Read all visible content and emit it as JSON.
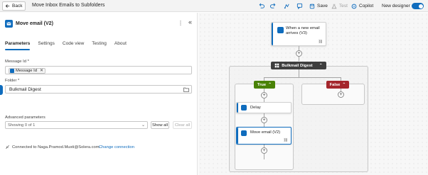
{
  "topbar": {
    "back_label": "Back",
    "flow_title": "Move Inbox Emails to Subfolders",
    "save_label": "Save",
    "test_label": "Test",
    "copilot_label": "Copilot",
    "new_designer_label": "New designer",
    "new_designer_on": true
  },
  "panel": {
    "title": "Move email (V2)",
    "tabs": [
      "Parameters",
      "Settings",
      "Code view",
      "Testing",
      "About"
    ],
    "active_tab": "Parameters",
    "message_id": {
      "label": "Message Id *",
      "token": "Message Id"
    },
    "folder": {
      "label": "Folder *",
      "value": "Bulkmail Digest"
    },
    "advanced": {
      "label": "Advanced parameters",
      "select_value": "Showing 0 of 1",
      "show_all": "Show all",
      "clear_all": "Clear all"
    },
    "connection": {
      "text": "Connected to Naga.Pramod.Musti@Solera.com.",
      "change_label": "Change connection"
    }
  },
  "canvas": {
    "trigger_text": "When a new email arrives (V3)",
    "condition_title": "Bulkmail Digest",
    "true_label": "True",
    "false_label": "False",
    "delay_label": "Delay",
    "move_email_label": "Move email (V2)"
  },
  "colors": {
    "accent": "#0f6cbd",
    "true_branch": "#498205",
    "false_branch": "#a4262c",
    "condition": "#3e3e3e"
  }
}
